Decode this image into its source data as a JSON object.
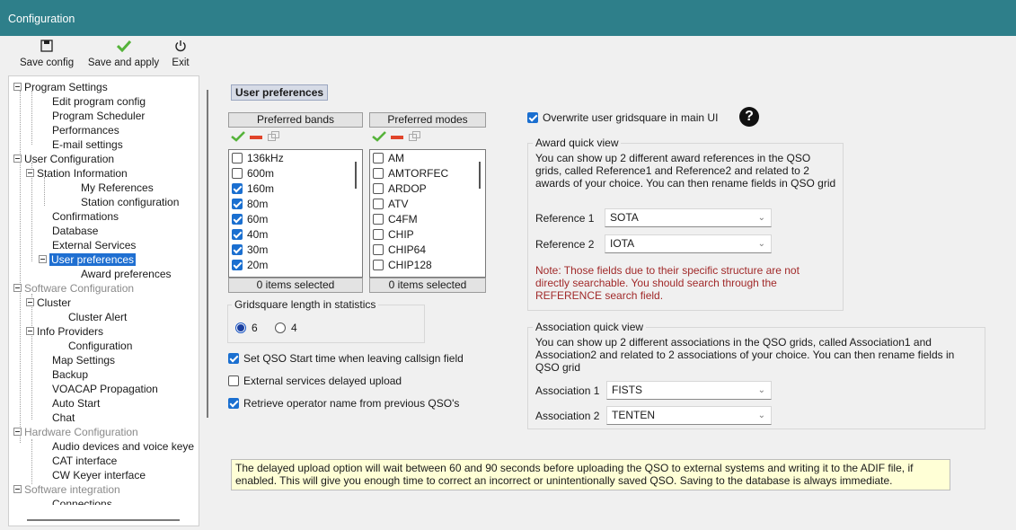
{
  "window": {
    "title": "Configuration"
  },
  "toolbar": {
    "save_config": "Save config",
    "save_apply": "Save and apply",
    "exit": "Exit"
  },
  "tree": {
    "items": [
      "Program Settings",
      "Edit program config",
      "Program Scheduler",
      "Performances",
      "E-mail settings",
      "User Configuration",
      "Station Information",
      "My References",
      "Station configuration",
      "Confirmations",
      "Database",
      "External Services",
      "User preferences",
      "Award preferences",
      "Software Configuration",
      "Cluster",
      "Cluster Alert",
      "Info Providers",
      "Configuration",
      "Map Settings",
      "Backup",
      "VOACAP Propagation",
      "Auto Start",
      "Chat",
      "Hardware Configuration",
      "Audio devices and voice keye",
      "CAT interface",
      "CW Keyer interface",
      "Software integration",
      "Connections"
    ]
  },
  "main": {
    "section_title": "User preferences",
    "bands": {
      "header": "Preferred bands",
      "footer": "0 items selected",
      "items": [
        {
          "label": "136kHz",
          "checked": false
        },
        {
          "label": "600m",
          "checked": false
        },
        {
          "label": "160m",
          "checked": true
        },
        {
          "label": "80m",
          "checked": true
        },
        {
          "label": "60m",
          "checked": true
        },
        {
          "label": "40m",
          "checked": true
        },
        {
          "label": "30m",
          "checked": true
        },
        {
          "label": "20m",
          "checked": true
        }
      ]
    },
    "modes": {
      "header": "Preferred modes",
      "footer": "0 items selected",
      "items": [
        {
          "label": "AM",
          "checked": false
        },
        {
          "label": "AMTORFEC",
          "checked": false
        },
        {
          "label": "ARDOP",
          "checked": false
        },
        {
          "label": "ATV",
          "checked": false
        },
        {
          "label": "C4FM",
          "checked": false
        },
        {
          "label": "CHIP",
          "checked": false
        },
        {
          "label": "CHIP64",
          "checked": false
        },
        {
          "label": "CHIP128",
          "checked": false
        }
      ]
    },
    "gridsquare": {
      "label": "Gridsquare length in statistics",
      "option_6": "6",
      "option_4": "4",
      "selected": "6"
    },
    "options": {
      "set_qso_start": "Set QSO Start time when leaving callsign field",
      "ext_delayed": "External services delayed upload",
      "retrieve_name": "Retrieve operator name from previous QSO's"
    },
    "overwrite_grid": "Overwrite user gridsquare in main UI",
    "award": {
      "label": "Award quick view",
      "text": "You can show up 2 different award references in the QSO grids, called Reference1 and Reference2 and related to 2 awards of your choice. You can then rename fields in QSO grid",
      "ref1_label": "Reference 1",
      "ref1_value": "SOTA",
      "ref2_label": "Reference 2",
      "ref2_value": "IOTA",
      "note": "Note: Those fields due to their specific structure are not directly searchable. You should search through the REFERENCE search field."
    },
    "association": {
      "label": "Association quick view",
      "text": "You can show up 2 different associations in the QSO grids, called Association1 and Association2 and related to 2 associations of your choice. You can then rename fields in QSO grid",
      "a1_label": "Association 1",
      "a1_value": "FISTS",
      "a2_label": "Association 2",
      "a2_value": "TENTEN"
    },
    "info": "The delayed upload option will wait between 60 and 90 seconds before uploading the QSO to external systems and writing it to the ADIF file, if enabled. This will give you enough time to correct an incorrect or unintentionally saved QSO. Saving to the database is always immediate."
  },
  "colors": {
    "titlebar": "#2e7f8a",
    "accent": "#1a6fd0",
    "note": "#a12a2a",
    "info_bg": "#ffffd6"
  }
}
